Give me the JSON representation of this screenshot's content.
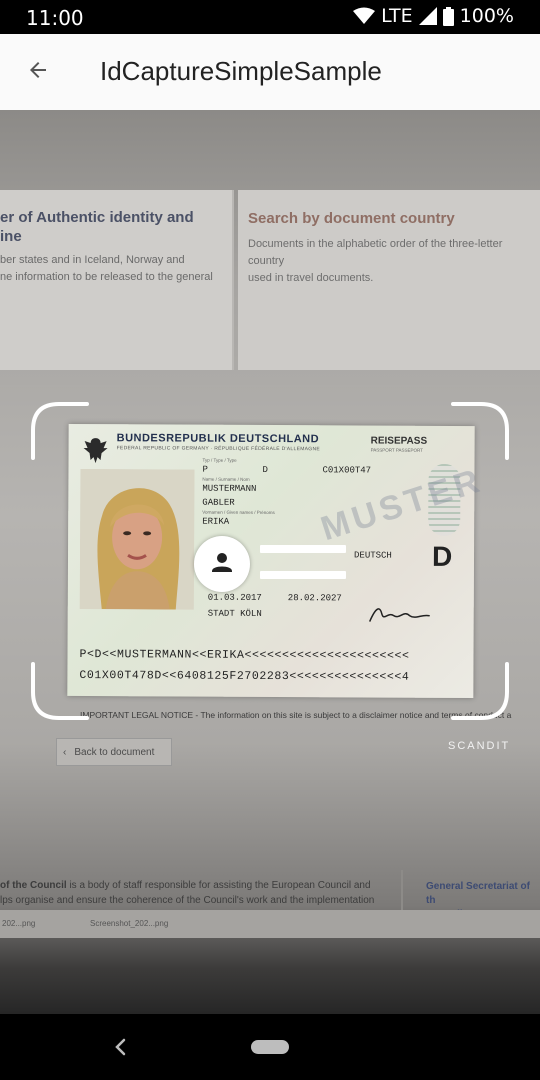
{
  "status_bar": {
    "time": "11:00",
    "network": "LTE",
    "battery": "100%"
  },
  "app_bar": {
    "title": "IdCaptureSimpleSample",
    "back_icon": "arrow-left-icon"
  },
  "background_page": {
    "card_left_title": "er of Authentic identity and\nine",
    "card_left_text": "ber states and in Iceland, Norway and\nne information to be released to the general",
    "card_right_title": "Search by document country",
    "card_right_text": "Documents in the alphabetic order of the three-letter country\nused in travel documents.",
    "legal_notice": "IMPORTANT LEGAL NOTICE - The information on this site is subject to a disclaimer notice and terms of conduct a",
    "back_to_document": "Back to document",
    "footer_text_bold": "of the Council",
    "footer_text": " is a body of staff responsible for assisting the European Council and\nlps organise and ensure the coherence of the Council's work and the implementation",
    "footer_link": "General Secretariat of th\nCouncil",
    "download_1": "202...png",
    "download_2": "Screenshot_202...png"
  },
  "document": {
    "country": "BUNDESREPUBLIK DEUTSCHLAND",
    "country_sub": "FEDERAL REPUBLIC OF GERMANY · RÉPUBLIQUE FÉDÉRALE D'ALLEMAGNE",
    "doc_type": "REISEPASS",
    "doc_type_sub": "PASSPORT PASSEPORT",
    "type_code": "P",
    "country_code": "D",
    "passport_no": "C01X00T47",
    "surname": "MUSTERMANN",
    "birth_name": "GABLER",
    "given_names": "ERIKA",
    "nationality": "DEUTSCH",
    "issue_date": "01.03.2017",
    "expiry_date": "28.02.2027",
    "authority": "STADT KÖLN",
    "nationality_letter": "D",
    "watermark": "MUSTER",
    "mrz_line_1": "P<D<<MUSTERMANN<<ERIKA<<<<<<<<<<<<<<<<<<<<<<",
    "mrz_line_2": "C01X00T478D<<6408125F2702283<<<<<<<<<<<<<<<4"
  },
  "overlay": {
    "brand": "SCANDIT",
    "scan_icon": "person-icon"
  },
  "nav_bar": {
    "back_icon": "nav-back-icon",
    "home_icon": "nav-home-pill-icon"
  }
}
